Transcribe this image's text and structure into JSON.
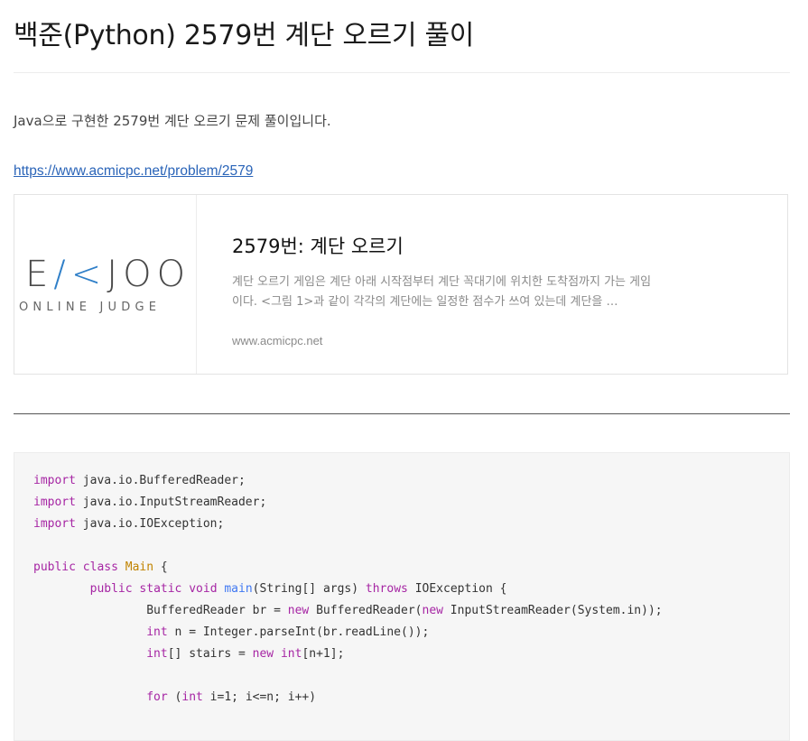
{
  "post": {
    "title": "백준(Python) 2579번 계단 오르기 풀이",
    "intro": "Java으로 구현한 2579번 계단 오르기 문제 풀이입니다.",
    "link": "https://www.acmicpc.net/problem/2579"
  },
  "card": {
    "logo_main_pre": "E",
    "logo_main_k": "/<",
    "logo_main_post": "JOO",
    "logo_sub": "ONLINE JUDGE",
    "title": "2579번: 계단 오르기",
    "description": "계단 오르기 게임은 계단 아래 시작점부터 계단 꼭대기에 위치한 도착점까지 가는 게임이다. <그림 1>과 같이 각각의 계단에는 일정한 점수가 쓰여 있는데 계단을 …",
    "domain": "www.acmicpc.net"
  },
  "code": {
    "l1_kw": "import",
    "l1_rest": " java.io.BufferedReader;",
    "l2_kw": "import",
    "l2_rest": " java.io.InputStreamReader;",
    "l3_kw": "import",
    "l3_rest": " java.io.IOException;",
    "l5_kw1": "public",
    "l5_sp1": " ",
    "l5_kw2": "class",
    "l5_sp2": " ",
    "l5_ty": "Main",
    "l5_rest": " {",
    "l6_indent": "        ",
    "l6_kw1": "public",
    "l6_sp1": " ",
    "l6_kw2": "static",
    "l6_sp2": " ",
    "l6_kw3": "void",
    "l6_sp3": " ",
    "l6_fn": "main",
    "l6_mid": "(String[] args) ",
    "l6_kw4": "throws",
    "l6_rest": " IOException {",
    "l7_indent": "                ",
    "l7_a": "BufferedReader br = ",
    "l7_kw1": "new",
    "l7_b": " BufferedReader(",
    "l7_kw2": "new",
    "l7_c": " InputStreamReader(System.in));",
    "l8_indent": "                ",
    "l8_kw": "int",
    "l8_rest": " n = Integer.parseInt(br.readLine());",
    "l9_indent": "                ",
    "l9_kw1": "int",
    "l9_a": "[] stairs = ",
    "l9_kw2": "new",
    "l9_sp": " ",
    "l9_kw3": "int",
    "l9_b": "[n+1];",
    "l11_indent": "                ",
    "l11_kw1": "for",
    "l11_a": " (",
    "l11_kw2": "int",
    "l11_b": " i=1; i<=n; i++)"
  }
}
